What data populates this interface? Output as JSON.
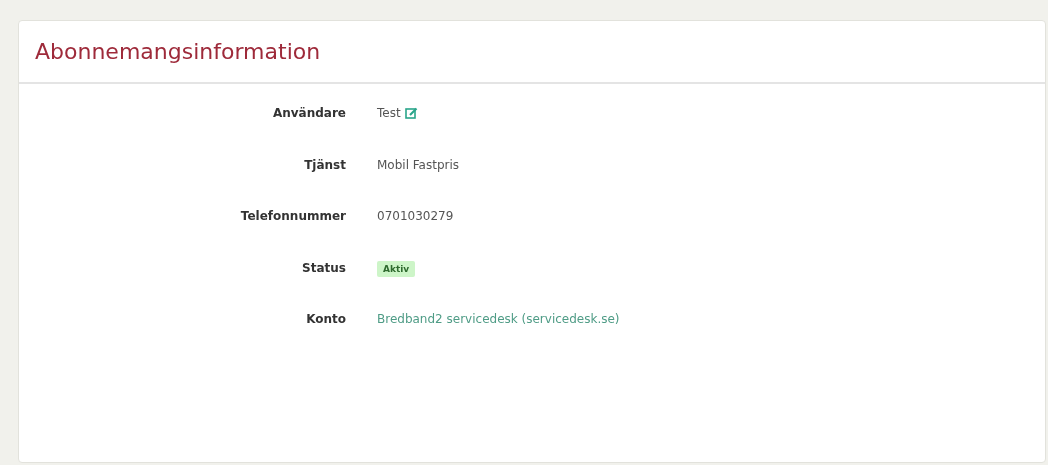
{
  "card": {
    "title": "Abonnemangsinformation"
  },
  "fields": [
    {
      "label": "Användare",
      "value": "Test",
      "kind": "editable"
    },
    {
      "label": "Tjänst",
      "value": "Mobil Fastpris",
      "kind": "text"
    },
    {
      "label": "Telefonnummer",
      "value": "0701030279",
      "kind": "text"
    },
    {
      "label": "Status",
      "value": "Aktiv",
      "kind": "badge"
    },
    {
      "label": "Konto",
      "value": "Bredband2 servicedesk (servicedesk.se)",
      "kind": "link"
    }
  ]
}
